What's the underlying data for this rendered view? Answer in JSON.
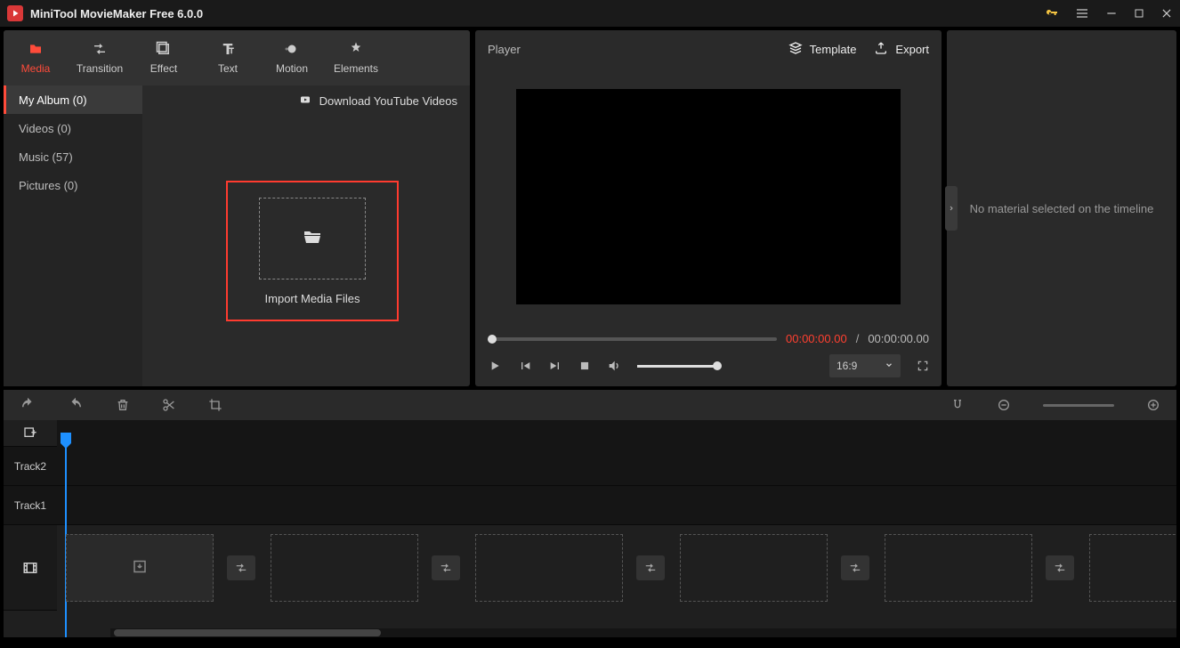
{
  "app": {
    "title": "MiniTool MovieMaker Free 6.0.0"
  },
  "tabs": {
    "media": "Media",
    "transition": "Transition",
    "effect": "Effect",
    "text": "Text",
    "motion": "Motion",
    "elements": "Elements"
  },
  "sidebar": {
    "my_album": "My Album (0)",
    "videos": "Videos (0)",
    "music": "Music (57)",
    "pictures": "Pictures (0)"
  },
  "media": {
    "download_yt": "Download YouTube Videos",
    "import_label": "Import Media Files"
  },
  "player": {
    "title": "Player",
    "template": "Template",
    "export": "Export",
    "time_current": "00:00:00.00",
    "time_sep": "/",
    "time_total": "00:00:00.00",
    "aspect": "16:9"
  },
  "right": {
    "empty_msg": "No material selected on the timeline"
  },
  "timeline": {
    "track2": "Track2",
    "track1": "Track1"
  }
}
